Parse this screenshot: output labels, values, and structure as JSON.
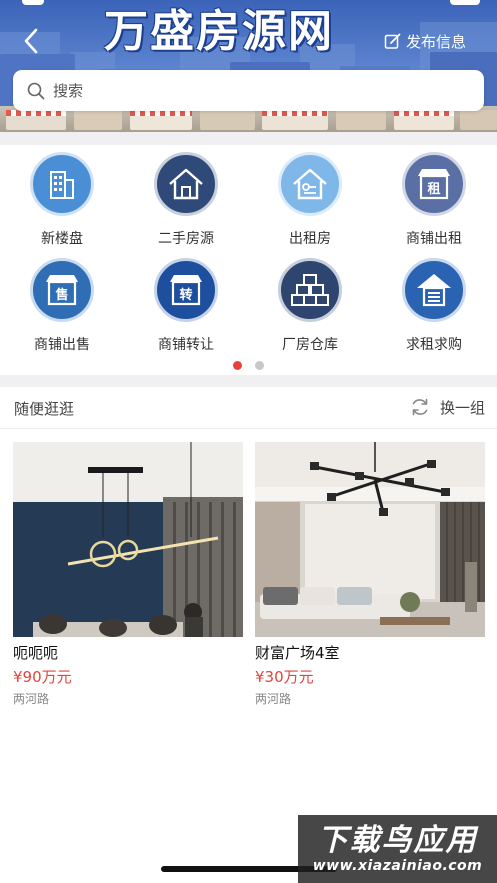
{
  "header": {
    "title": "万盛房源网",
    "publish_label": "发布信息"
  },
  "search": {
    "placeholder": "搜索"
  },
  "categories": [
    {
      "label": "新楼盘",
      "icon": "building-icon",
      "color": "#4a8fd6"
    },
    {
      "label": "二手房源",
      "icon": "house-icon",
      "color": "#2f4a78"
    },
    {
      "label": "出租房",
      "icon": "rent-house-icon",
      "color": "#7fb8e8"
    },
    {
      "label": "商铺出租",
      "icon": "shop-rent-icon",
      "color": "#5a6fa3",
      "glyph": "租"
    },
    {
      "label": "商铺出售",
      "icon": "shop-sale-icon",
      "color": "#2f6db5",
      "glyph": "售"
    },
    {
      "label": "商铺转让",
      "icon": "shop-transfer-icon",
      "color": "#1d4f9e",
      "glyph": "转"
    },
    {
      "label": "厂房仓库",
      "icon": "warehouse-icon",
      "color": "#2e4570"
    },
    {
      "label": "求租求购",
      "icon": "upload-house-icon",
      "color": "#2b63b3"
    }
  ],
  "pager": {
    "pages": 2,
    "active": 1
  },
  "browse": {
    "title": "随便逛逛",
    "refresh_label": "换一组"
  },
  "listings": [
    {
      "name": "呃呃呃",
      "price": "¥90万元",
      "address": "两河路"
    },
    {
      "name": "财富广场4室",
      "price": "¥30万元",
      "address": "两河路"
    }
  ],
  "watermark": {
    "logo": "下载鸟应用",
    "url": "www.xiazainiao.com"
  },
  "colors": {
    "accent_red": "#e0463c",
    "banner_blue": "#3b63b8"
  }
}
